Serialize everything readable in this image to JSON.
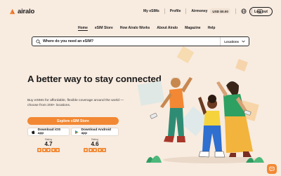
{
  "brand": {
    "name": "airalo",
    "accent": "#f28833"
  },
  "topnav": {
    "my_esims": "My eSIMs",
    "profile": "Profile",
    "airmoney": "Airmoney",
    "balance": "USD $0.00",
    "logout": "Log out",
    "icons": [
      "globe-icon",
      "wallet-icon"
    ]
  },
  "mainnav": {
    "items": [
      {
        "label": "Home"
      },
      {
        "label": "eSIM Store"
      },
      {
        "label": "How Airalo Works"
      },
      {
        "label": "About Airalo"
      },
      {
        "label": "Magazine"
      },
      {
        "label": "Help"
      }
    ]
  },
  "search": {
    "placeholder": "Where do you need an eSIM?",
    "scope": "Locations"
  },
  "hero": {
    "title": "A better way to stay connected",
    "subtitle": "Buy eSIMs for affordable, flexible coverage around the world — choose from 200+ locations.",
    "cta": "Explore eSIM Store",
    "ios_button": "Download iOS app",
    "android_button": "Download Android app"
  },
  "ratings": [
    {
      "label": "Rating",
      "value": "4.7",
      "stars": 5
    },
    {
      "label": "Rating",
      "value": "4.6",
      "stars": 5
    }
  ]
}
